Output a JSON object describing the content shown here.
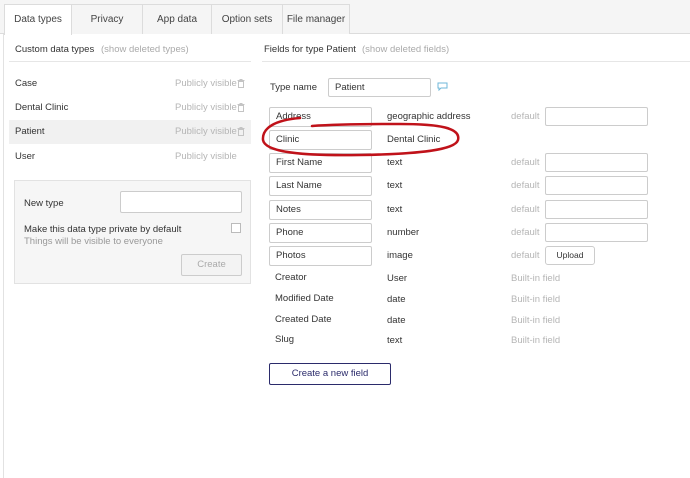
{
  "tabs": [
    "Data types",
    "Privacy",
    "App data",
    "Option sets",
    "File manager"
  ],
  "left": {
    "title": "Custom data types",
    "show_deleted": "(show deleted types)",
    "types": [
      {
        "name": "Case",
        "visibility": "Publicly visible"
      },
      {
        "name": "Dental Clinic",
        "visibility": "Publicly visible"
      },
      {
        "name": "Patient",
        "visibility": "Publicly visible"
      },
      {
        "name": "User",
        "visibility": "Publicly visible"
      }
    ],
    "new_type": {
      "label": "New type",
      "input_value": "",
      "private_label": "Make this data type private by default",
      "private_hint": "Things will be visible to everyone",
      "create_label": "Create"
    }
  },
  "right": {
    "title": "Fields for type Patient",
    "show_deleted": "(show deleted fields)",
    "type_name_label": "Type name",
    "type_name_value": "Patient",
    "fields": [
      {
        "name": "Address",
        "type": "geographic address",
        "default": "default"
      },
      {
        "name": "Clinic",
        "type": "Dental Clinic",
        "default": ""
      },
      {
        "name": "First Name",
        "type": "text",
        "default": "default"
      },
      {
        "name": "Last Name",
        "type": "text",
        "default": "default"
      },
      {
        "name": "Notes",
        "type": "text",
        "default": "default"
      },
      {
        "name": "Phone",
        "type": "number",
        "default": "default"
      },
      {
        "name": "Photos",
        "type": "image",
        "default": "default",
        "upload_label": "Upload"
      },
      {
        "name": "Creator",
        "type": "User",
        "default": "Built-in field"
      },
      {
        "name": "Modified Date",
        "type": "date",
        "default": "Built-in field"
      },
      {
        "name": "Created Date",
        "type": "date",
        "default": "Built-in field"
      },
      {
        "name": "Slug",
        "type": "text",
        "default": "Built-in field"
      }
    ],
    "new_field_label": "Create a new field"
  },
  "colors": {
    "annotation": "#c0121a",
    "accent_button": "#2b2b6b"
  }
}
